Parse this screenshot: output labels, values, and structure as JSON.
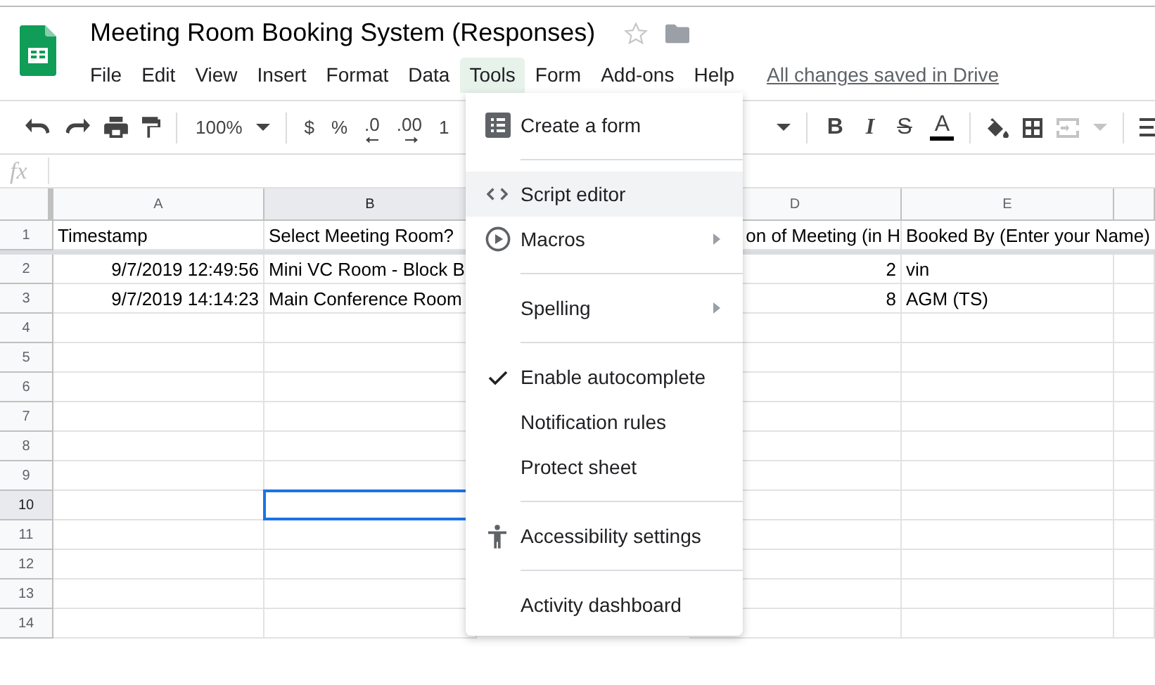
{
  "document": {
    "title": "Meeting Room Booking System (Responses)",
    "starred": false
  },
  "menubar": [
    {
      "label": "File",
      "selected": false
    },
    {
      "label": "Edit",
      "selected": false
    },
    {
      "label": "View",
      "selected": false
    },
    {
      "label": "Insert",
      "selected": false
    },
    {
      "label": "Format",
      "selected": false
    },
    {
      "label": "Data",
      "selected": false
    },
    {
      "label": "Tools",
      "selected": true
    },
    {
      "label": "Form",
      "selected": false
    },
    {
      "label": "Add-ons",
      "selected": false
    },
    {
      "label": "Help",
      "selected": false
    }
  ],
  "save_status": "All changes saved in Drive",
  "toolbar": {
    "zoom": "100%",
    "currency": "$",
    "percent": "%",
    "decrease_decimal": ".0",
    "increase_decimal": ".00",
    "more_formats": "1",
    "bold": "B",
    "italic": "I",
    "strikethrough": "S",
    "text_color": "A",
    "merge_disabled": true
  },
  "formula_bar": {
    "label": "fx"
  },
  "columns": [
    {
      "label": "A",
      "selected": false
    },
    {
      "label": "B",
      "selected": true
    },
    {},
    {
      "label": "D",
      "selected": false
    },
    {
      "label": "E",
      "selected": false
    },
    {
      "selected": false
    }
  ],
  "rows": [
    {
      "label": "1",
      "selected": false,
      "cells": {
        "a": {
          "text": "Timestamp",
          "kind": "text"
        },
        "b": {
          "text": "Select Meeting Room?",
          "kind": "text"
        },
        "d": {
          "text": "on of Meeting (in H",
          "kind": "clipped"
        },
        "e": {
          "text": "Booked By (Enter your Name)",
          "kind": "overflow"
        }
      }
    },
    {
      "label": "2",
      "selected": false,
      "cells": {
        "a": {
          "text": "9/7/2019 12:49:56",
          "kind": "number"
        },
        "b": {
          "text": "Mini VC Room - Block B",
          "kind": "text"
        },
        "d": {
          "text": "2",
          "kind": "number"
        },
        "e": {
          "text": "vin",
          "kind": "text"
        }
      }
    },
    {
      "label": "3",
      "selected": false,
      "cells": {
        "a": {
          "text": "9/7/2019 14:14:23",
          "kind": "number"
        },
        "b": {
          "text": "Main Conference Room",
          "kind": "text"
        },
        "d": {
          "text": "8",
          "kind": "number"
        },
        "e": {
          "text": "AGM (TS)",
          "kind": "text"
        }
      }
    },
    {
      "label": "4",
      "selected": false
    },
    {
      "label": "5",
      "selected": false
    },
    {
      "label": "6",
      "selected": false
    },
    {
      "label": "7",
      "selected": false
    },
    {
      "label": "8",
      "selected": false
    },
    {
      "label": "9",
      "selected": false
    },
    {
      "label": "10",
      "selected": true
    },
    {
      "label": "11",
      "selected": false
    },
    {
      "label": "12",
      "selected": false
    },
    {
      "label": "13",
      "selected": false
    },
    {
      "label": "14",
      "selected": false
    }
  ],
  "tools_menu": [
    {
      "kind": "item",
      "label": "Create a form",
      "highlighted": false
    },
    {
      "kind": "separator"
    },
    {
      "kind": "item",
      "label": "Script editor",
      "highlighted": true
    },
    {
      "kind": "item",
      "label": "Macros",
      "highlighted": false,
      "submenu": true
    },
    {
      "kind": "separator"
    },
    {
      "kind": "item",
      "label": "Spelling",
      "highlighted": false,
      "submenu": true
    },
    {
      "kind": "separator"
    },
    {
      "kind": "item",
      "label": "Enable autocomplete",
      "highlighted": false,
      "checked": true
    },
    {
      "kind": "item",
      "label": "Notification rules",
      "highlighted": false
    },
    {
      "kind": "item",
      "label": "Protect sheet",
      "highlighted": false
    },
    {
      "kind": "separator"
    },
    {
      "kind": "item",
      "label": "Accessibility settings",
      "highlighted": false
    },
    {
      "kind": "separator"
    },
    {
      "kind": "item",
      "label": "Activity dashboard",
      "highlighted": false
    }
  ]
}
